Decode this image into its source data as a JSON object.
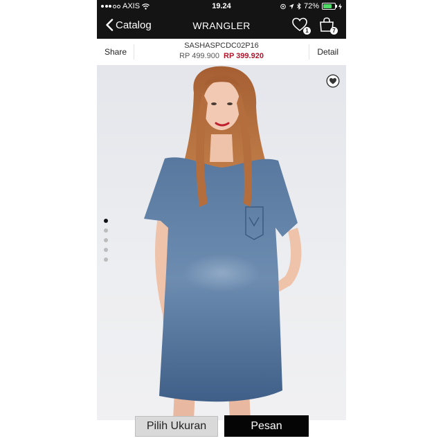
{
  "status_bar": {
    "carrier": "AXIS",
    "time": "19.24",
    "battery": "72%",
    "battery_level": 0.72,
    "signal_dots": 5,
    "signal_filled": 3
  },
  "nav": {
    "back_label": "Catalog",
    "title": "WRANGLER",
    "wishlist_count": "1",
    "cart_count": "7"
  },
  "product": {
    "sku": "SASHASPCDC02P16",
    "old_price": "RP 499.900",
    "new_price": "RP 399.920",
    "share_label": "Share",
    "detail_label": "Detail",
    "image_count": 5,
    "active_image": 0
  },
  "actions": {
    "size_label": "Pilih Ukuran",
    "order_label": "Pesan"
  },
  "colors": {
    "bar_bg": "#141414",
    "sale_price": "#b0152c",
    "denim": "#4d6f9a",
    "hair": "#b56a39"
  },
  "icons": [
    "wifi-icon",
    "location-icon",
    "bluetooth-icon",
    "battery-icon",
    "back-chevron-icon",
    "heart-icon",
    "shopping-bag-icon",
    "favorite-heart-icon"
  ]
}
